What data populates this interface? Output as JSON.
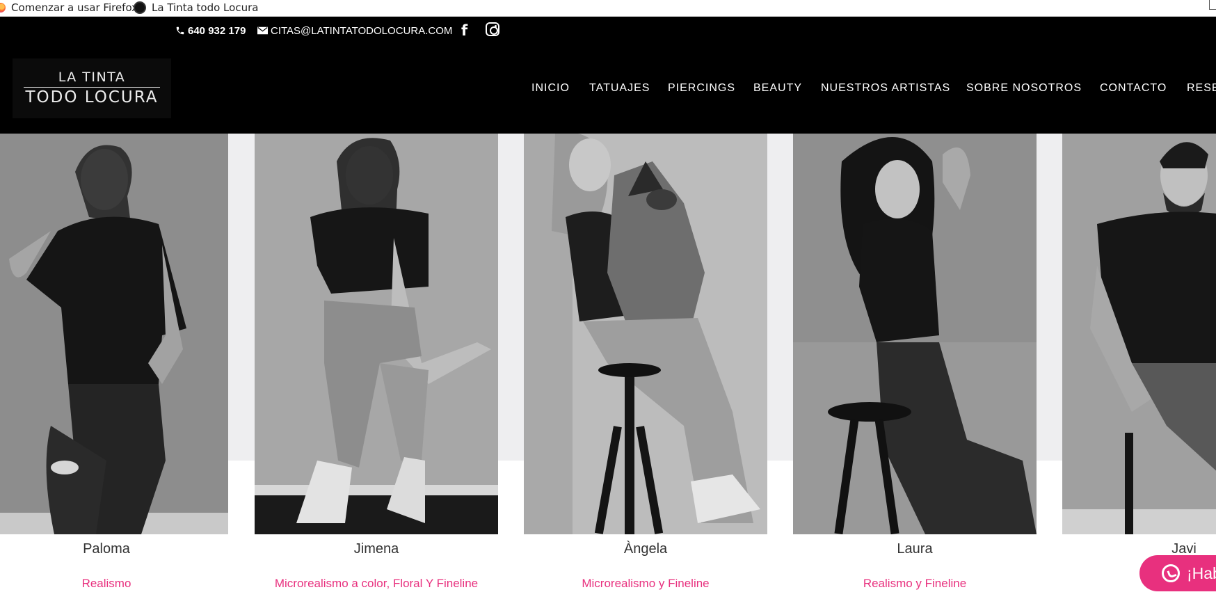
{
  "browser": {
    "bookmarks": [
      {
        "label": "Comenzar a usar Firefox",
        "icon": "firefox-icon"
      },
      {
        "label": "La Tinta todo Locura",
        "icon": "site-favicon-icon"
      }
    ]
  },
  "topbar": {
    "phone": "640 932 179",
    "email": "CITAS@LATINTATODOLOCURA.COM",
    "social": [
      {
        "icon": "facebook-icon",
        "glyph": "f"
      },
      {
        "icon": "instagram-icon"
      }
    ]
  },
  "header": {
    "logo_line1": "LA TINTA",
    "logo_line2": "TODO LOCURA",
    "nav": [
      "INICIO",
      "TATUAJES",
      "PIERCINGS",
      "BEAUTY",
      "NUESTROS ARTISTAS",
      "SOBRE NOSOTROS",
      "CONTACTO",
      "RESE"
    ]
  },
  "artists": [
    {
      "name": "Paloma",
      "style": "Realismo"
    },
    {
      "name": "Jimena",
      "style": "Microrealismo a color, Floral Y Fineline"
    },
    {
      "name": "Àngela",
      "style": "Microrealismo y Fineline"
    },
    {
      "name": "Laura",
      "style": "Realismo y Fineline"
    },
    {
      "name": "Javi",
      "style": ""
    }
  ],
  "whatsapp": {
    "label": "¡Hab"
  },
  "colors": {
    "accent": "#e8307e",
    "header_bg": "#000000",
    "gallery_bg": "#eeeef0"
  }
}
